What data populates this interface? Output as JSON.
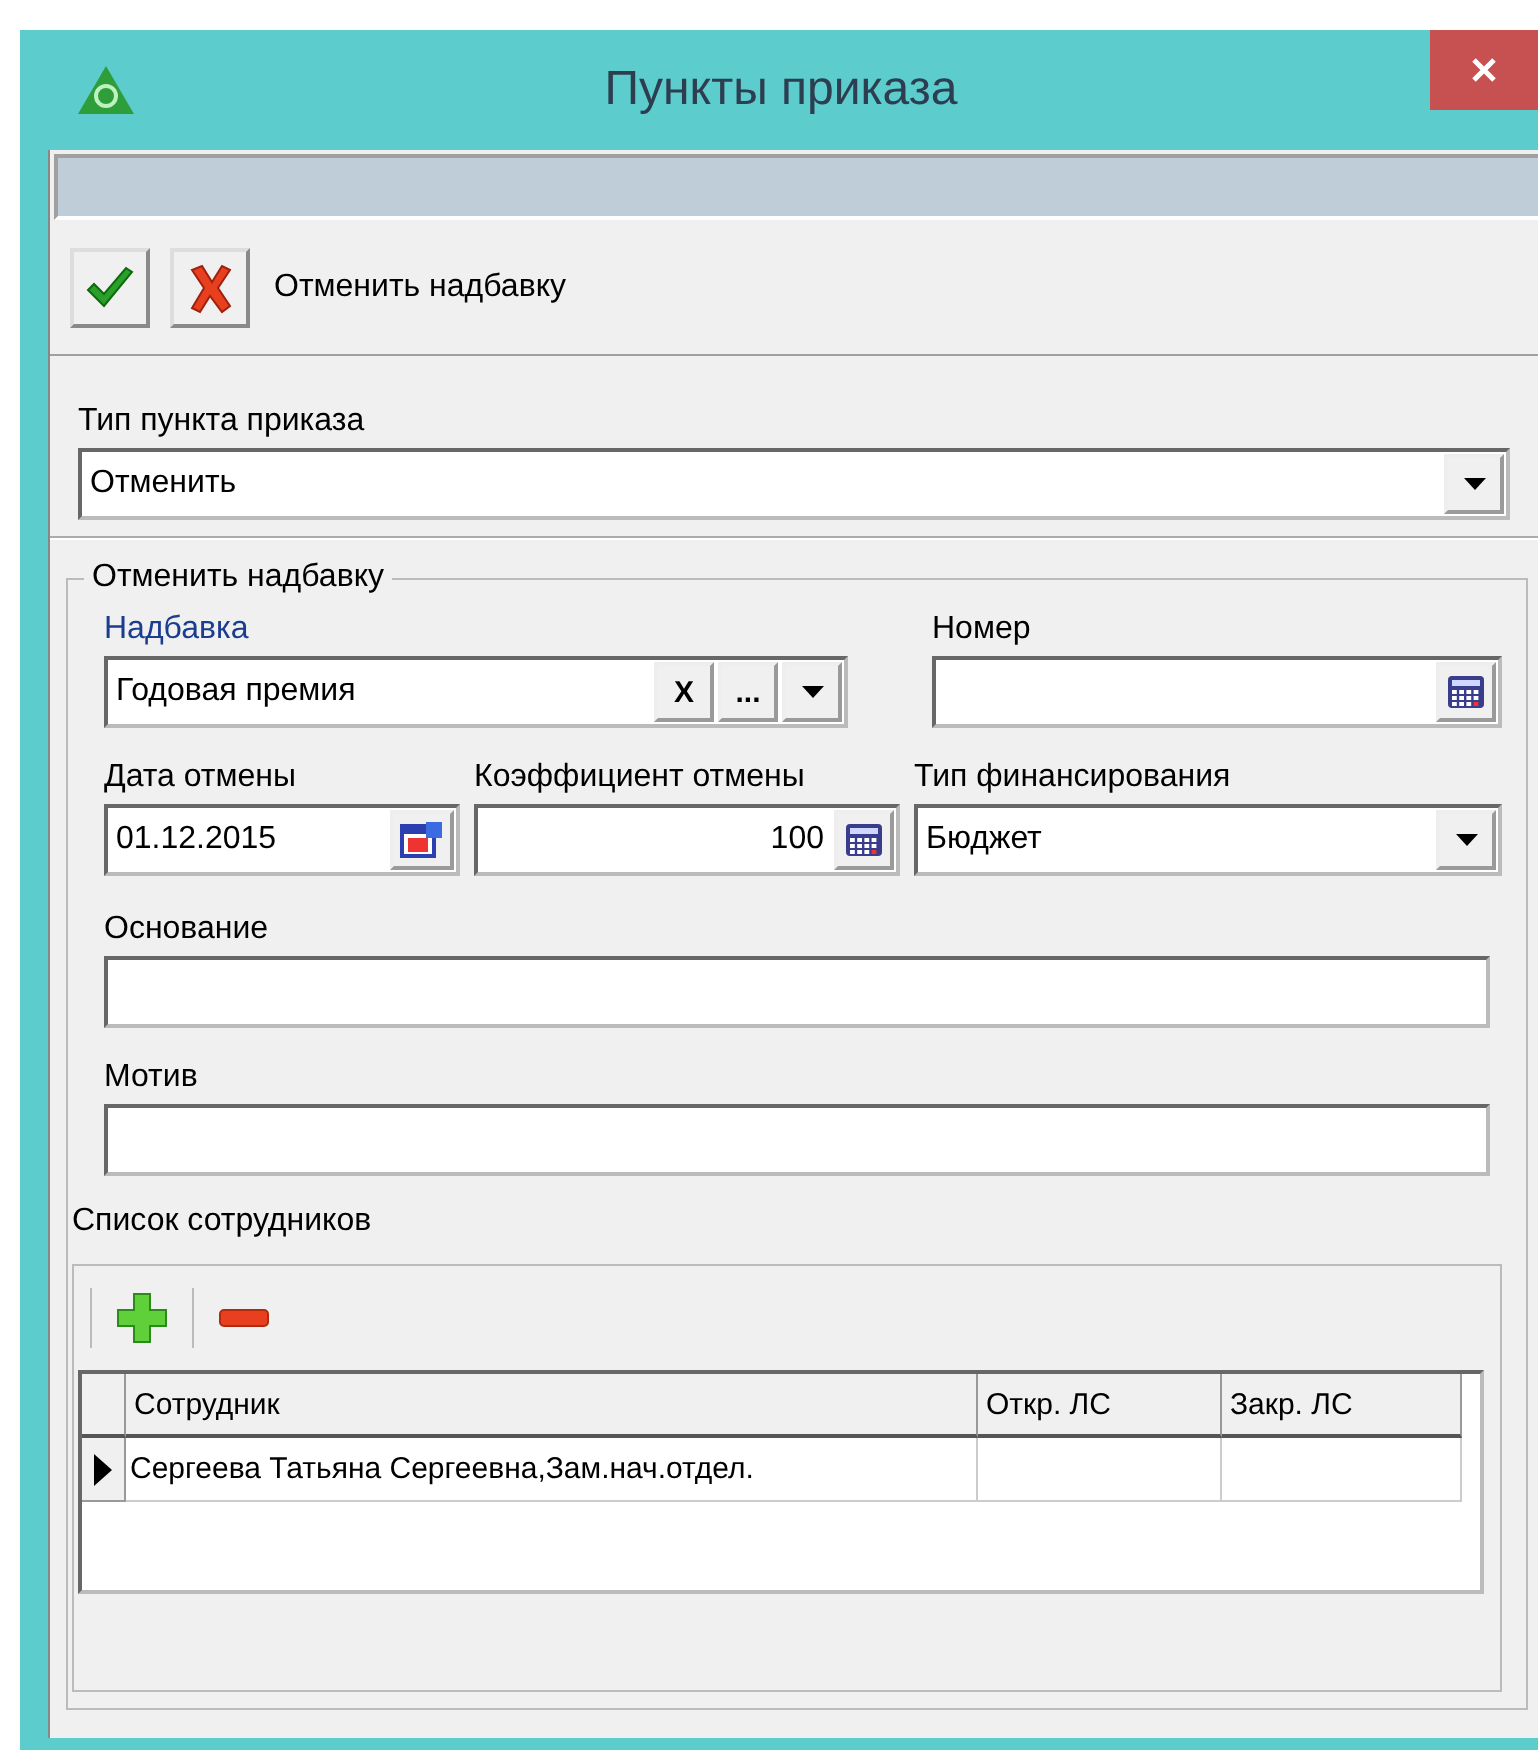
{
  "window": {
    "title": "Пункты приказа"
  },
  "toolbar": {
    "buttons": [
      {
        "kind": "ok"
      },
      {
        "kind": "cancel"
      }
    ],
    "caption": "Отменить надбавку"
  },
  "order_item_type": {
    "label": "Тип пункта приказа",
    "value": "Отменить"
  },
  "group": {
    "legend": "Отменить надбавку",
    "allowance": {
      "label": "Надбавка",
      "emphasis": true,
      "value": "Годовая премия",
      "clear": "X",
      "browse": "..."
    },
    "number": {
      "label": "Номер",
      "emphasis": false
    },
    "cancel_date": {
      "label": "Дата отмены",
      "emphasis": false,
      "value": "01.12.2015"
    },
    "coefficient": {
      "label": "Коэффициент отмены",
      "emphasis": false,
      "value": "100"
    },
    "funding_type": {
      "label": "Тип финансирования",
      "emphasis": false,
      "value": "Бюджет"
    },
    "basis": {
      "label": "Основание",
      "emphasis": false
    },
    "motive": {
      "label": "Мотив",
      "emphasis": false
    },
    "employees": {
      "label": "Список сотрудников",
      "columns": [
        "Сотрудник",
        "Откр. ЛС",
        "Закр. ЛС"
      ],
      "rows": [
        {
          "selected": true,
          "cells": [
            "Сергеева Татьяна Сергеевна,Зам.нач.отдел.",
            "",
            ""
          ]
        }
      ]
    }
  }
}
